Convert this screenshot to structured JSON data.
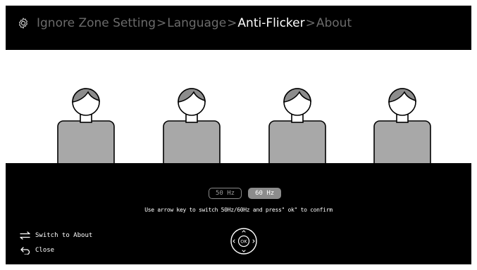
{
  "breadcrumb": {
    "items": [
      "Ignore Zone Setting",
      "Language",
      "Anti-Flicker",
      "About"
    ],
    "separator": ">",
    "active_index": 2
  },
  "frequency": {
    "options": [
      "50 Hz",
      "60 Hz"
    ],
    "selected": "60 Hz"
  },
  "hint_text": "Use arrow key to switch 50Hz/60Hz and press\" ok\" to confirm",
  "actions": {
    "switch_label": "Switch to About",
    "close_label": "Close"
  },
  "nav_pad": {
    "center_label": "OK"
  },
  "icons": [
    "gear-icon",
    "swap-arrows-icon",
    "back-arrow-icon",
    "dpad-icon"
  ],
  "colors": {
    "background": "#000000",
    "accent_selected": "#8c8c8c",
    "inactive_text": "#6b6b6b"
  }
}
